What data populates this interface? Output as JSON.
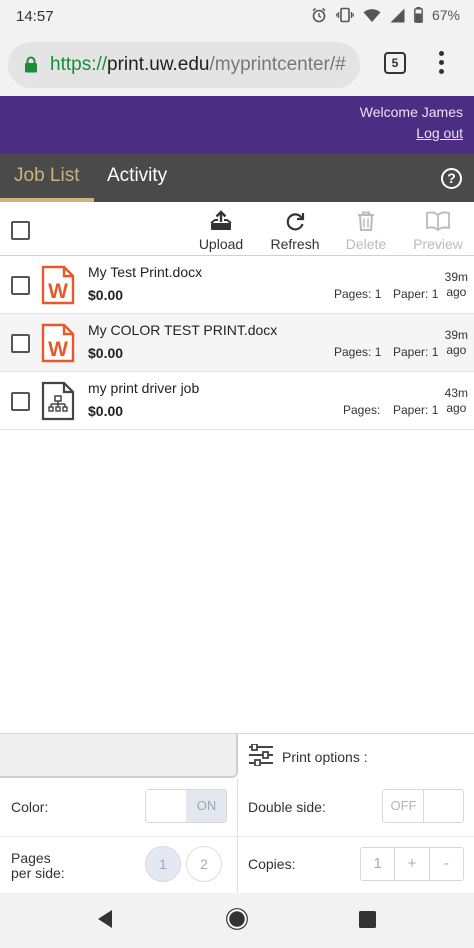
{
  "status_bar": {
    "time": "14:57",
    "battery": "67%",
    "icons": [
      "alarm-icon",
      "vibrate-icon",
      "wifi-icon",
      "signal-icon",
      "battery-icon"
    ]
  },
  "browser": {
    "url_scheme": "https://",
    "url_host": "print.uw.edu",
    "url_path": "/myprintcenter/#",
    "tab_count": "5"
  },
  "header": {
    "welcome": "Welcome James",
    "logout": "Log out",
    "brand_color": "#4b2e83"
  },
  "nav": {
    "tabs": [
      {
        "label": "Job List",
        "active": true
      },
      {
        "label": "Activity",
        "active": false
      }
    ],
    "help": "?"
  },
  "toolbar": {
    "actions": [
      {
        "label": "Upload",
        "icon": "upload-icon",
        "enabled": true
      },
      {
        "label": "Refresh",
        "icon": "refresh-icon",
        "enabled": true
      },
      {
        "label": "Delete",
        "icon": "trash-icon",
        "enabled": false
      },
      {
        "label": "Preview",
        "icon": "book-icon",
        "enabled": false
      }
    ]
  },
  "jobs": [
    {
      "name": "My Test Print.docx",
      "cost": "$0.00",
      "pages": "Pages: 1",
      "paper": "Paper: 1",
      "time_line1": "39m",
      "time_line2": "ago",
      "icon": "word-doc-icon"
    },
    {
      "name": "My COLOR TEST PRINT.docx",
      "cost": "$0.00",
      "pages": "Pages: 1",
      "paper": "Paper: 1",
      "time_line1": "39m",
      "time_line2": "ago",
      "icon": "word-doc-icon"
    },
    {
      "name": "my print driver job",
      "cost": "$0.00",
      "pages": "Pages:",
      "paper": "Paper: 1",
      "time_line1": "43m",
      "time_line2": "ago",
      "icon": "print-driver-doc-icon"
    }
  ],
  "print_options": {
    "title": "Print options :",
    "color_label": "Color:",
    "color_value": "ON",
    "double_side_label": "Double side:",
    "double_side_value": "OFF",
    "pages_per_side_label_1": "Pages",
    "pages_per_side_label_2": "per side:",
    "pages_per_side_options": [
      "1",
      "2"
    ],
    "pages_per_side_selected": "1",
    "copies_label": "Copies:",
    "copies_value": "1",
    "copies_plus": "+",
    "copies_minus": "-"
  }
}
